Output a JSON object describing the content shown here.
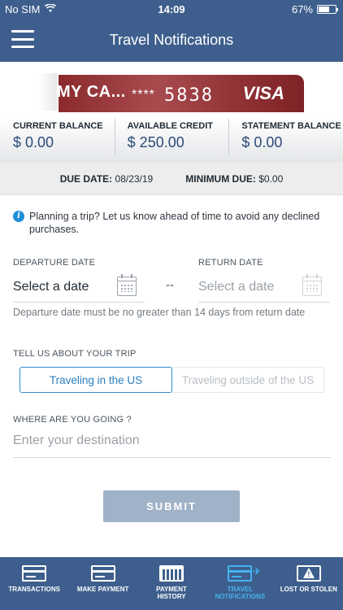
{
  "status_bar": {
    "carrier": "No SIM",
    "time": "14:09",
    "battery": "67%",
    "battery_level": 0.67
  },
  "header": {
    "title": "Travel Notifications"
  },
  "card": {
    "name": "MY CA...",
    "mask": "****",
    "last4": "5838",
    "brand": "VISA"
  },
  "balances": [
    {
      "label": "CURRENT BALANCE",
      "value": "$ 0.00"
    },
    {
      "label": "AVAILABLE CREDIT",
      "value": "$ 250.00"
    },
    {
      "label": "STATEMENT BALANCE",
      "value": "$ 0.00"
    }
  ],
  "due": {
    "date_label": "DUE DATE:",
    "date_value": "08/23/19",
    "min_label": "MINIMUM DUE:",
    "min_value": "$0.00"
  },
  "info": {
    "text": "Planning a trip? Let us know ahead of time to avoid any declined purchases."
  },
  "form": {
    "departure_label": "DEPARTURE DATE",
    "departure_value": "Select a date",
    "separator": "--",
    "return_label": "RETURN DATE",
    "return_value": "Select a date",
    "hint": "Departure date must be no greater than 14 days from return date",
    "trip_label": "TELL US ABOUT YOUR TRIP",
    "trip_options": [
      "Traveling in the US",
      "Traveling outside of the US"
    ],
    "destination_label": "WHERE ARE YOU GOING ?",
    "destination_placeholder": "Enter your destination",
    "submit": "SUBMIT"
  },
  "tabs": [
    {
      "label1": "TRANSACTIONS",
      "label2": "",
      "icon": "card-icon"
    },
    {
      "label1": "MAKE PAYMENT",
      "label2": "",
      "icon": "card-icon"
    },
    {
      "label1": "PAYMENT",
      "label2": "HISTORY",
      "icon": "calendar-grid-icon"
    },
    {
      "label1": "TRAVEL",
      "label2": "NOTIFICATIONS",
      "icon": "card-plane-icon"
    },
    {
      "label1": "LOST OR STOLEN",
      "label2": "",
      "icon": "card-warning-icon"
    }
  ],
  "colors": {
    "header": "#3e5f8d",
    "accent": "#2f8ccf",
    "active_tab": "#45b3f0",
    "submit": "#a0b2c8"
  }
}
